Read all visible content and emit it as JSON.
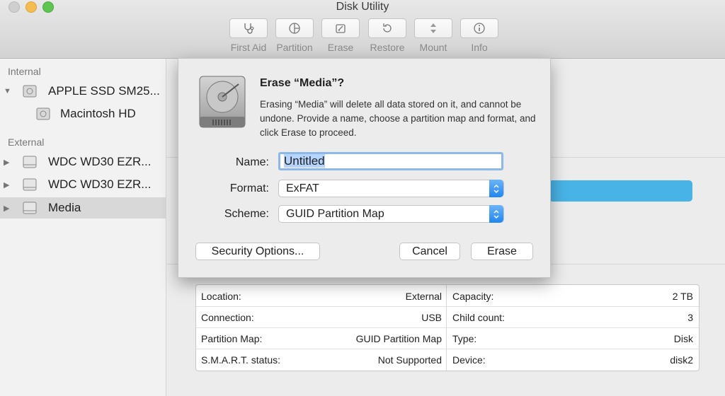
{
  "window": {
    "title": "Disk Utility"
  },
  "toolbar": {
    "buttons": [
      {
        "label": "First Aid",
        "icon": "stethoscope-icon"
      },
      {
        "label": "Partition",
        "icon": "partition-icon"
      },
      {
        "label": "Erase",
        "icon": "erase-icon"
      },
      {
        "label": "Restore",
        "icon": "restore-icon"
      },
      {
        "label": "Mount",
        "icon": "mount-icon"
      },
      {
        "label": "Info",
        "icon": "info-icon"
      }
    ]
  },
  "sidebar": {
    "internal_label": "Internal",
    "external_label": "External",
    "items": [
      {
        "label": "APPLE SSD SM25..."
      },
      {
        "label": "Macintosh HD"
      },
      {
        "label": "WDC WD30 EZR..."
      },
      {
        "label": "WDC WD30 EZR..."
      },
      {
        "label": "Media"
      }
    ]
  },
  "dialog": {
    "title": "Erase “Media”?",
    "message": "Erasing “Media” will delete all data stored on it, and cannot be undone. Provide a name, choose a partition map and format, and click Erase to proceed.",
    "name_label": "Name:",
    "name_value": "Untitled",
    "format_label": "Format:",
    "format_value": "ExFAT",
    "scheme_label": "Scheme:",
    "scheme_value": "GUID Partition Map",
    "security_button": "Security Options...",
    "cancel_button": "Cancel",
    "erase_button": "Erase"
  },
  "info": {
    "rows": [
      {
        "k1": "Location:",
        "v1": "External",
        "k2": "Capacity:",
        "v2": "2 TB"
      },
      {
        "k1": "Connection:",
        "v1": "USB",
        "k2": "Child count:",
        "v2": "3"
      },
      {
        "k1": "Partition Map:",
        "v1": "GUID Partition Map",
        "k2": "Type:",
        "v2": "Disk"
      },
      {
        "k1": "S.M.A.R.T. status:",
        "v1": "Not Supported",
        "k2": "Device:",
        "v2": "disk2"
      }
    ]
  },
  "colors": {
    "accent": "#48b3e6",
    "popup_arrow": "#1e87f0",
    "selection": "#b5d5ff"
  }
}
